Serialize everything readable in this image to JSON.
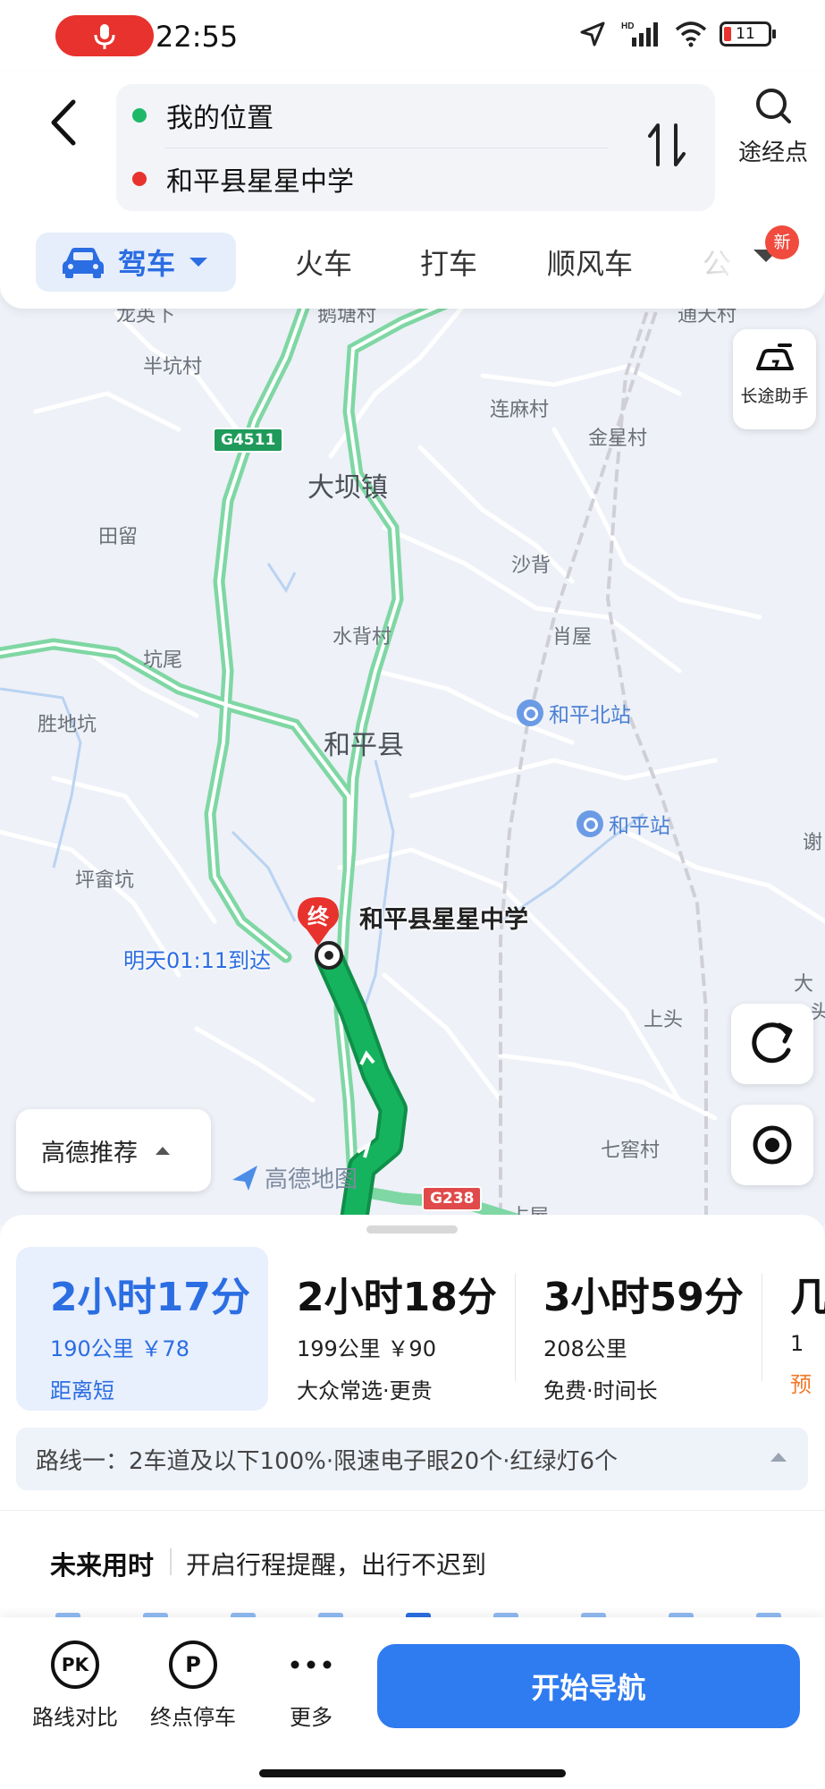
{
  "status_bar": {
    "time": "22:55",
    "battery": "11"
  },
  "origin": "我的位置",
  "destination": "和平县星星中学",
  "waypoint_label": "途经点",
  "modes": {
    "active": "驾车",
    "tabs": [
      "火车",
      "打车",
      "顺风车",
      "公"
    ],
    "new_badge": "新"
  },
  "map": {
    "places": [
      "龙英下",
      "鹅塘村",
      "通天村",
      "半坑村",
      "连麻村",
      "金星村",
      "田留",
      "沙背",
      "水背村",
      "肖屋",
      "坑尾",
      "胜地坑",
      "坪畲坑",
      "上头",
      "七窖村",
      "谢",
      "大",
      "头",
      "占屋"
    ],
    "towns": [
      "大坝镇",
      "和平县"
    ],
    "stations": [
      "和平北站",
      "和平站"
    ],
    "road_shields": [
      "G4511",
      "G238"
    ],
    "destination_pin": "终",
    "destination_label": "和平县星星中学",
    "arrival": "明天01:11到达",
    "watermark": "高德地图",
    "long_trip_helper": "长途助手",
    "recommend_label": "高德推荐"
  },
  "routes": [
    {
      "duration": "2小时17分",
      "meta": "190公里 ￥78",
      "tag": "距离短"
    },
    {
      "duration": "2小时18分",
      "meta": "199公里 ￥90",
      "tag": "大众常选·更贵"
    },
    {
      "duration": "3小时59分",
      "meta": "208公里",
      "tag": "免费·时间长"
    },
    {
      "duration": "几",
      "meta": "1",
      "tag": "预"
    }
  ],
  "route_info": "路线一：2车道及以下100%·限速电子眼20个·红绿灯6个",
  "future": {
    "title": "未来用时",
    "desc": "开启行程提醒，出行不迟到"
  },
  "actions": {
    "compare": "路线对比",
    "parking": "终点停车",
    "more": "更多",
    "pk_glyph": "PK",
    "p_glyph": "P"
  },
  "start_nav": "开始导航",
  "colors": {
    "accent": "#2b6de2",
    "route": "#1aae5f",
    "start_button": "#2f7bf0"
  }
}
